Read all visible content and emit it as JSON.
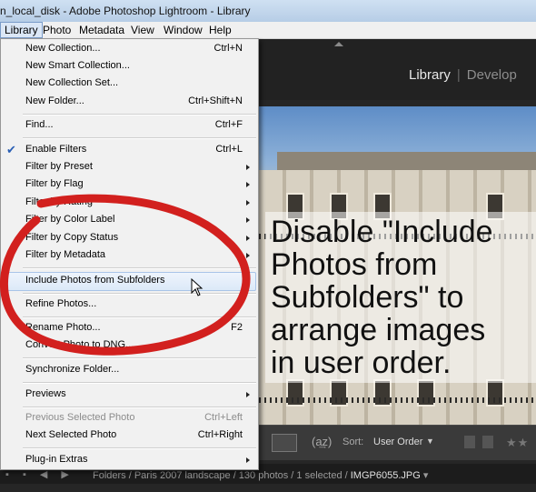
{
  "window": {
    "title": "n_local_disk - Adobe Photoshop Lightroom - Library"
  },
  "menubar": {
    "items": [
      "Library",
      "Photo",
      "Metadata",
      "View",
      "Window",
      "Help"
    ],
    "active": "Library"
  },
  "modules": {
    "library": "Library",
    "develop": "Develop",
    "separator": "|"
  },
  "menu": {
    "new_collection": {
      "label": "New Collection...",
      "shortcut": "Ctrl+N"
    },
    "new_smart_collection": {
      "label": "New Smart Collection..."
    },
    "new_collection_set": {
      "label": "New Collection Set..."
    },
    "new_folder": {
      "label": "New Folder...",
      "shortcut": "Ctrl+Shift+N"
    },
    "find": {
      "label": "Find...",
      "shortcut": "Ctrl+F"
    },
    "enable_filters": {
      "label": "Enable Filters",
      "shortcut": "Ctrl+L",
      "checked": true
    },
    "filter_by_preset": {
      "label": "Filter by Preset"
    },
    "filter_by_flag": {
      "label": "Filter by Flag"
    },
    "filter_by_rating": {
      "label": "Filter by Rating"
    },
    "filter_by_color_label": {
      "label": "Filter by Color Label"
    },
    "filter_by_copy_status": {
      "label": "Filter by Copy Status"
    },
    "filter_by_metadata": {
      "label": "Filter by Metadata"
    },
    "include_subfolders": {
      "label": "Include Photos from Subfolders",
      "highlighted": true
    },
    "refine_photos": {
      "label": "Refine Photos..."
    },
    "rename_photo": {
      "label": "Rename Photo...",
      "shortcut": "F2"
    },
    "convert_to_dng": {
      "label": "Convert Photo to DNG..."
    },
    "synchronize_folder": {
      "label": "Synchronize Folder..."
    },
    "previews": {
      "label": "Previews"
    },
    "previous_photo": {
      "label": "Previous Selected Photo",
      "shortcut": "Ctrl+Left",
      "disabled": true
    },
    "next_photo": {
      "label": "Next Selected Photo",
      "shortcut": "Ctrl+Right"
    },
    "plugin_extras": {
      "label": "Plug-in Extras"
    }
  },
  "annotation": {
    "text": "Disable \"Include\nPhotos from\nSubfolders\" to\narrange images\nin user order."
  },
  "toolbar": {
    "sort_icon": "a-z-sort-icon",
    "sort_label": "Sort:",
    "sort_value": "User Order"
  },
  "filmstrip": {
    "path": "Folders / Paris 2007 landscape / 130 photos / 1 selected /",
    "filename": "IMGP6055.JPG"
  },
  "colors": {
    "annotation_red": "#d2201e",
    "menu_highlight": "#dce9f8",
    "check_blue": "#2a5fb5"
  }
}
